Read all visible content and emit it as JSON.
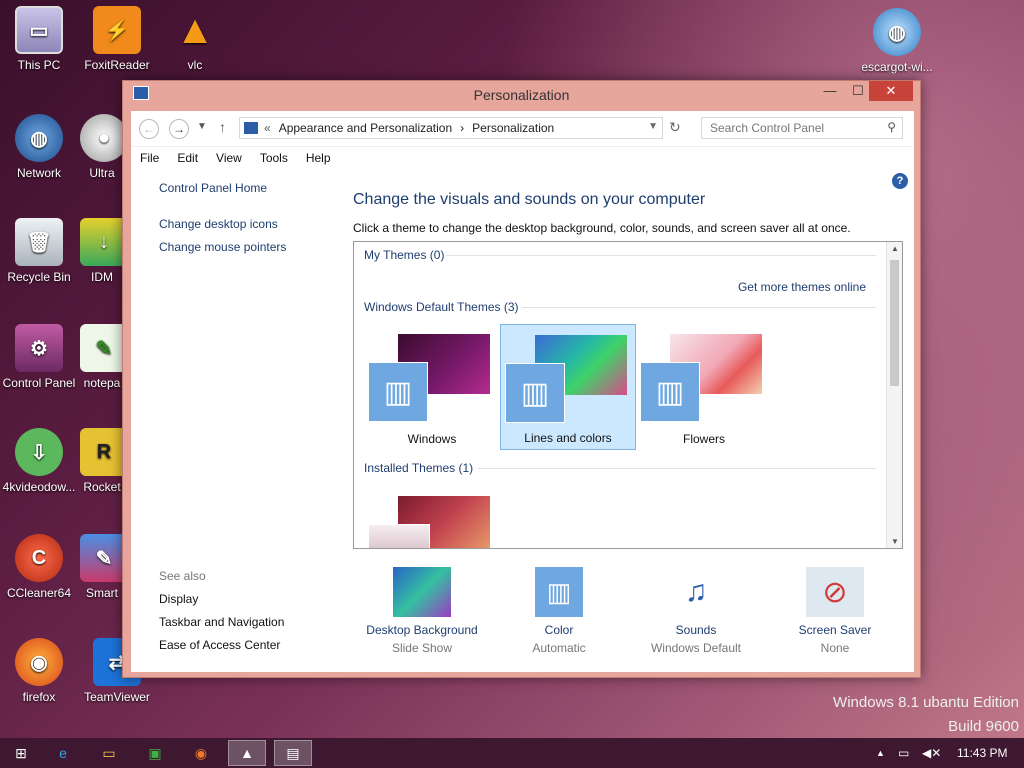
{
  "desktop": {
    "icons": [
      {
        "label": "This PC",
        "icon": "computer-icon",
        "color": "#9a9ab8"
      },
      {
        "label": "FoxitReader",
        "icon": "pdf-icon",
        "color": "#f08a1c"
      },
      {
        "label": "vlc",
        "icon": "vlc-cone-icon",
        "color": "#f59a15"
      },
      {
        "label": "escargot-wi...",
        "icon": "globe-icon",
        "color": "#4a90c8"
      },
      {
        "label": "Network",
        "icon": "globe-icon",
        "color": "#2d6ab0"
      },
      {
        "label": "Ultra",
        "icon": "disc-icon",
        "color": "#b7b7c9"
      },
      {
        "label": "Recycle Bin",
        "icon": "recycle-bin-icon",
        "color": "#cdd3d9"
      },
      {
        "label": "IDM",
        "icon": "idm-icon",
        "color": "#3aa85a"
      },
      {
        "label": "Control Panel",
        "icon": "control-panel-icon",
        "color": "#8e3b7a"
      },
      {
        "label": "notepa",
        "icon": "notepad-icon",
        "color": "#6fb24b"
      },
      {
        "label": "4kvideodow...",
        "icon": "download-icon",
        "color": "#5cb85c"
      },
      {
        "label": "Rocket",
        "icon": "rocket-icon",
        "color": "#e5c232"
      },
      {
        "label": "CCleaner64",
        "icon": "ccleaner-icon",
        "color": "#d9412a"
      },
      {
        "label": "Smart",
        "icon": "smart-icon",
        "color": "#2c6cc9"
      },
      {
        "label": "firefox",
        "icon": "firefox-icon",
        "color": "#e8661c"
      },
      {
        "label": "TeamViewer",
        "icon": "teamviewer-icon",
        "color": "#1e73d8"
      }
    ],
    "watermark_line1": "Windows 8.1 ubantu Edition",
    "watermark_line2": "Build 9600"
  },
  "window": {
    "title": "Personalization",
    "controls": {
      "minimize": "—",
      "maximize": "☐",
      "close": "✕"
    },
    "address": {
      "prefix": "«",
      "crumb1": "Appearance and Personalization",
      "sep": "›",
      "crumb2": "Personalization"
    },
    "search_placeholder": "Search Control Panel",
    "menu": [
      "File",
      "Edit",
      "View",
      "Tools",
      "Help"
    ],
    "left": {
      "home": "Control Panel Home",
      "links": [
        "Change desktop icons",
        "Change mouse pointers"
      ],
      "see_also_title": "See also",
      "see_also": [
        "Display",
        "Taskbar and Navigation",
        "Ease of Access Center"
      ]
    },
    "heading": "Change the visuals and sounds on your computer",
    "description": "Click a theme to change the desktop background, color, sounds, and screen saver all at once.",
    "themes": {
      "my_themes": "My Themes (0)",
      "get_more": "Get more themes online",
      "default_title": "Windows Default Themes (3)",
      "items": [
        "Windows",
        "Lines and colors",
        "Flowers"
      ],
      "selected": "Lines and colors",
      "installed_title": "Installed Themes (1)"
    },
    "bottom": [
      {
        "label": "Desktop Background",
        "value": "Slide Show",
        "icon": "desktop-background-icon"
      },
      {
        "label": "Color",
        "value": "Automatic",
        "icon": "color-palette-icon"
      },
      {
        "label": "Sounds",
        "value": "Windows Default",
        "icon": "sounds-icon"
      },
      {
        "label": "Screen Saver",
        "value": "None",
        "icon": "screen-saver-icon"
      }
    ]
  },
  "taskbar": {
    "time": "11:43 PM"
  }
}
